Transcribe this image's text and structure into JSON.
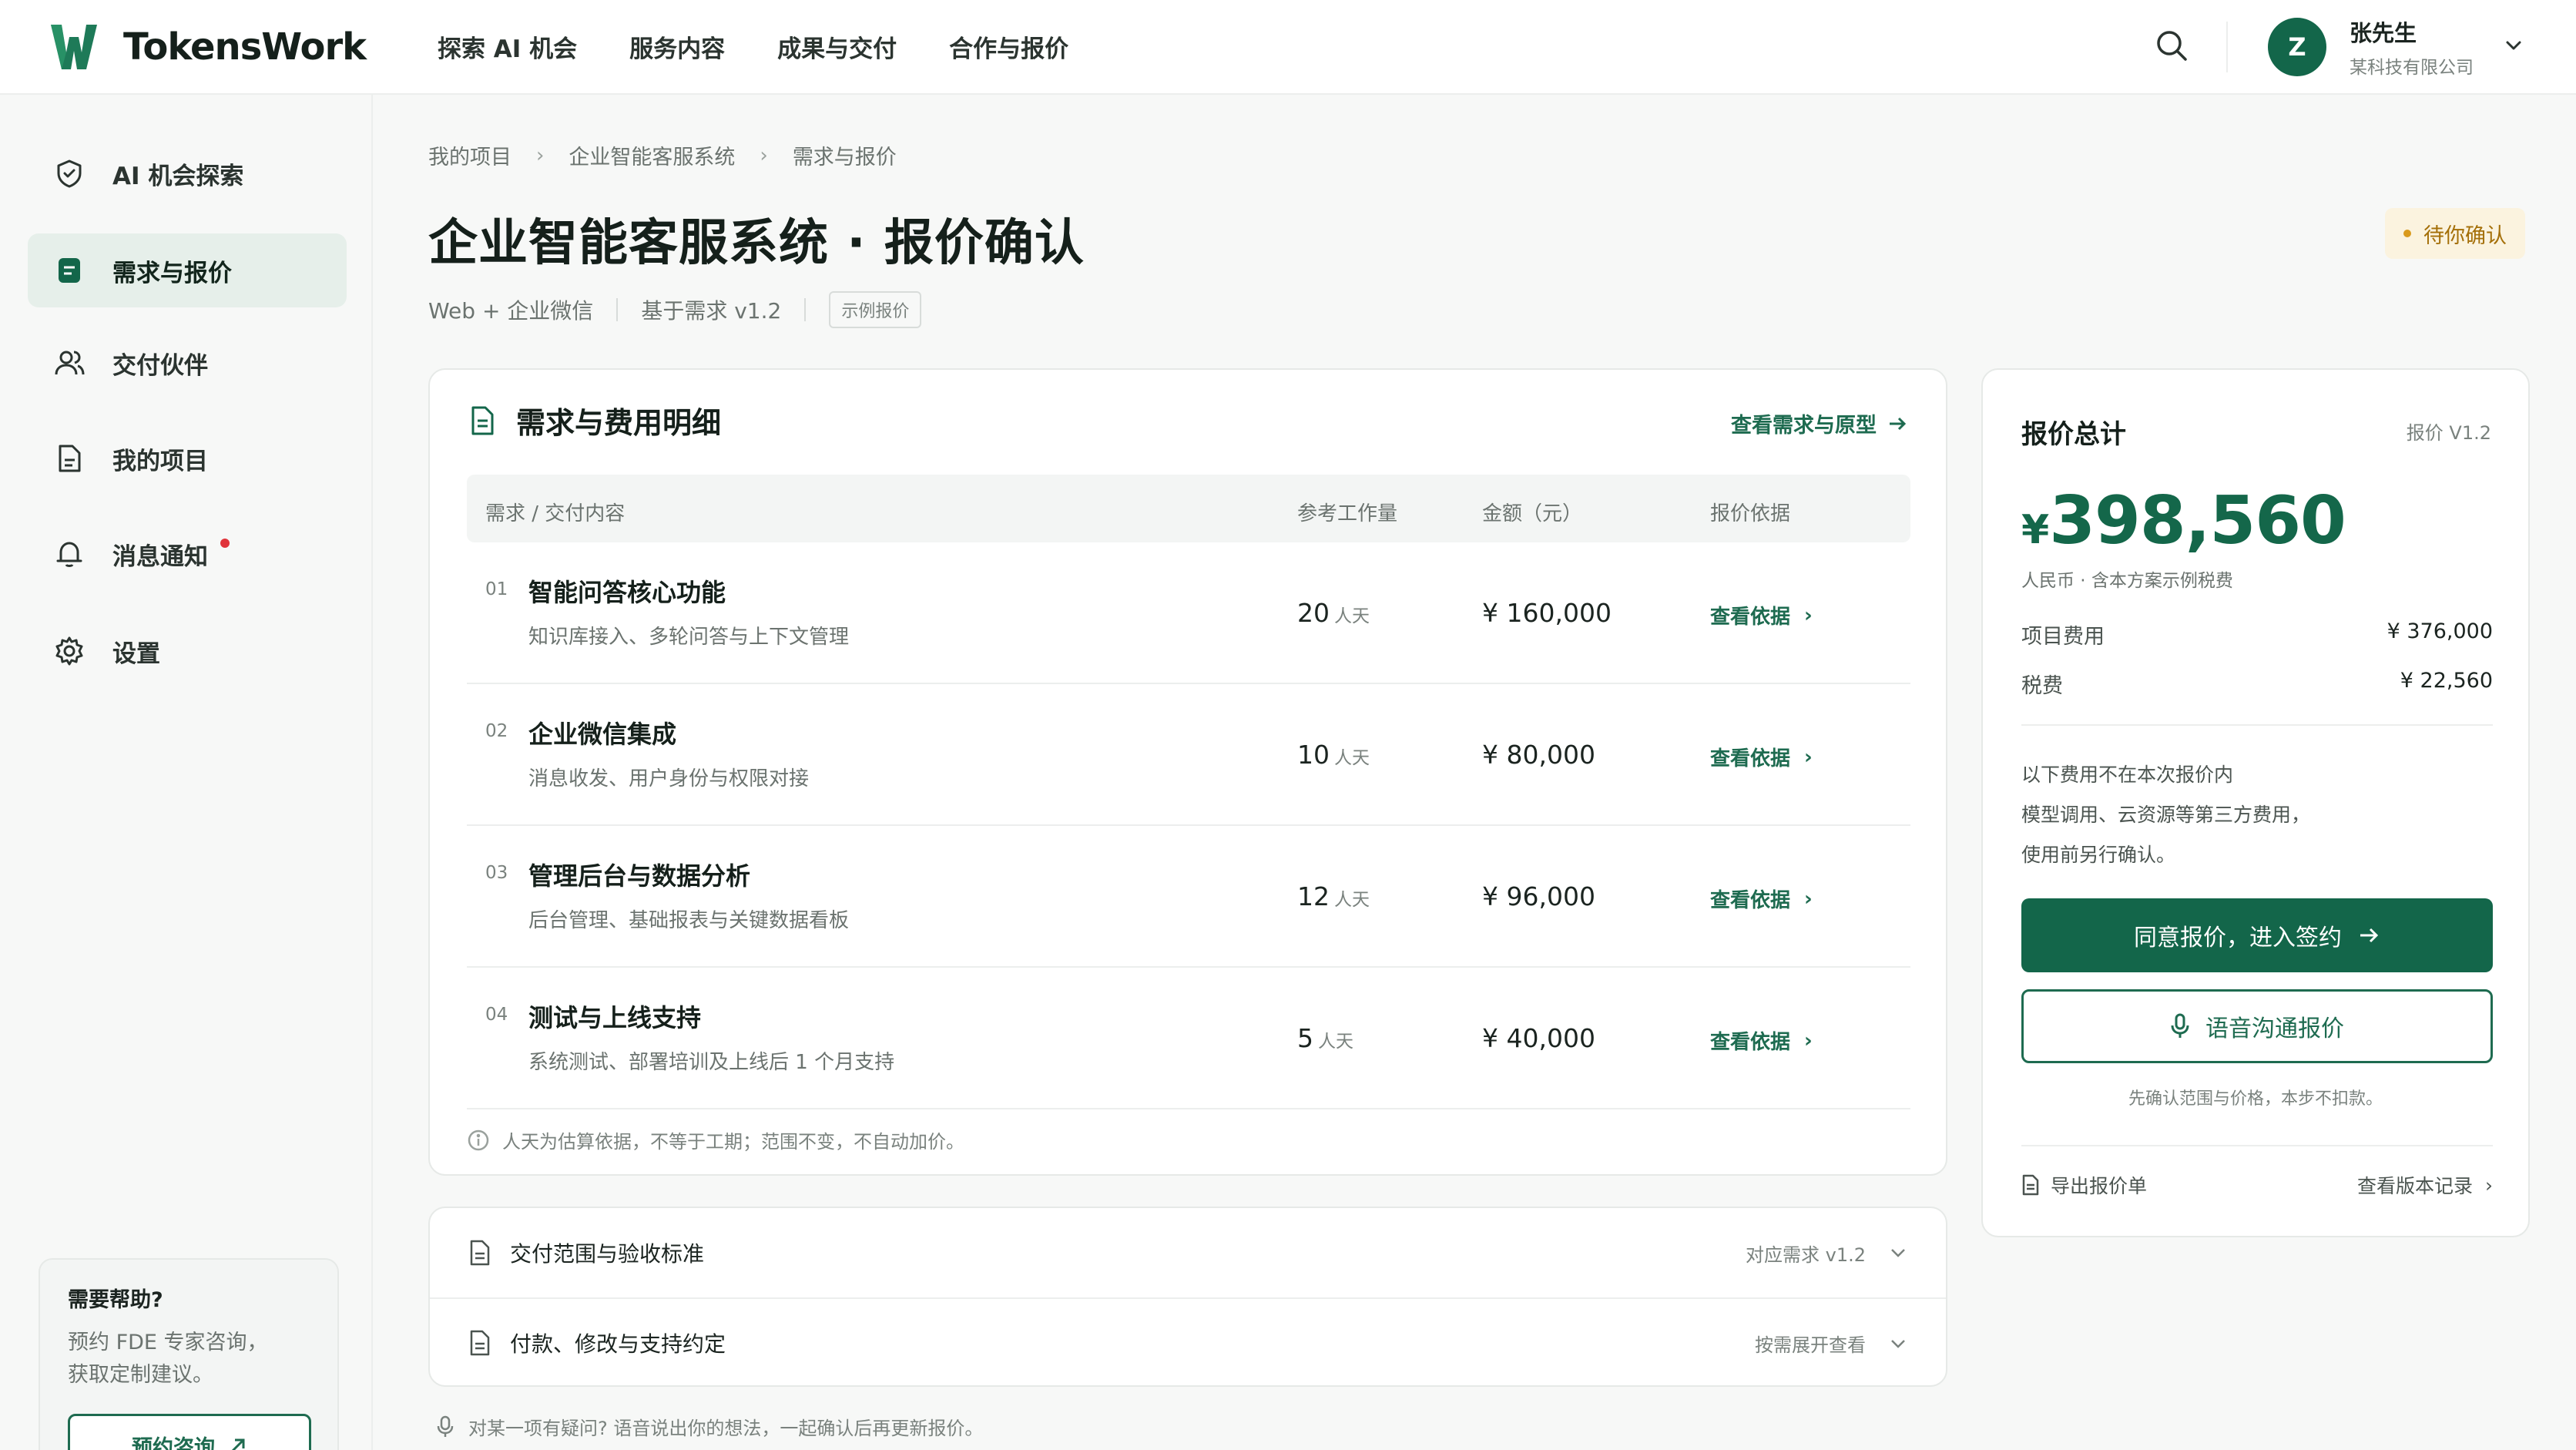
{
  "brand": {
    "name": "TokensWork",
    "accent": "#13664a"
  },
  "nav": {
    "links": [
      "探索 AI 机会",
      "服务内容",
      "成果与交付",
      "合作与报价"
    ]
  },
  "user": {
    "initial": "Z",
    "name": "张先生",
    "company": "某科技有限公司"
  },
  "sidebar": {
    "items": [
      {
        "label": "AI 机会探索",
        "icon": "shield-check-icon"
      },
      {
        "label": "需求与报价",
        "icon": "document-check-icon"
      },
      {
        "label": "交付伙伴",
        "icon": "users-icon"
      },
      {
        "label": "我的项目",
        "icon": "file-icon"
      },
      {
        "label": "消息通知",
        "icon": "bell-icon"
      },
      {
        "label": "设置",
        "icon": "gear-icon"
      }
    ],
    "help": {
      "title": "需要帮助?",
      "desc_line1": "预约 FDE 专家咨询，",
      "desc_line2": "获取定制建议。",
      "button": "预约咨询"
    }
  },
  "breadcrumb": [
    "我的项目",
    "企业智能客服系统",
    "需求与报价"
  ],
  "page": {
    "title": "企业智能客服系统 · 报价确认",
    "meta_platform": "Web + 企业微信",
    "meta_basis": "基于需求 v1.2",
    "meta_tag": "示例报价",
    "status": "待你确认",
    "status_color": "#d99a1c"
  },
  "details": {
    "title": "需求与费用明细",
    "link": "查看需求与原型",
    "columns": [
      "需求 / 交付内容",
      "参考工作量",
      "金额（元）",
      "报价依据"
    ],
    "rows": [
      {
        "num": "01",
        "title": "智能问答核心功能",
        "desc": "知识库接入、多轮问答与上下文管理",
        "work": "20",
        "unit": "人天",
        "amount": "¥ 160,000",
        "link": "查看依据"
      },
      {
        "num": "02",
        "title": "企业微信集成",
        "desc": "消息收发、用户身份与权限对接",
        "work": "10",
        "unit": "人天",
        "amount": "¥ 80,000",
        "link": "查看依据"
      },
      {
        "num": "03",
        "title": "管理后台与数据分析",
        "desc": "后台管理、基础报表与关键数据看板",
        "work": "12",
        "unit": "人天",
        "amount": "¥ 96,000",
        "link": "查看依据"
      },
      {
        "num": "04",
        "title": "测试与上线支持",
        "desc": "系统测试、部署培训及上线后 1 个月支持",
        "work": "5",
        "unit": "人天",
        "amount": "¥ 40,000",
        "link": "查看依据"
      }
    ],
    "note": "人天为估算依据，不等于工期；范围不变，不自动加价。"
  },
  "collapsibles": [
    {
      "label": "交付范围与验收标准",
      "hint": "对应需求 v1.2"
    },
    {
      "label": "付款、修改与支持约定",
      "hint": "按需展开查看"
    }
  ],
  "voice_note": "对某一项有疑问? 语音说出你的想法，一起确认后再更新报价。",
  "quote": {
    "title": "报价总计",
    "version": "报价 V1.2",
    "currency": "¥",
    "total": "398,560",
    "sub": "人民币 · 含本方案示例税费",
    "lines": [
      {
        "label": "项目费用",
        "value": "¥ 376,000"
      },
      {
        "label": "税费",
        "value": "¥ 22,560"
      }
    ],
    "excl_line1": "以下费用不在本次报价内",
    "excl_line2": "模型调用、云资源等第三方费用，",
    "excl_line3": "使用前另行确认。",
    "primary": "同意报价，进入签约",
    "secondary": "语音沟通报价",
    "hint": "先确认范围与价格，本步不扣款。",
    "export": "导出报价单",
    "history": "查看版本记录"
  }
}
